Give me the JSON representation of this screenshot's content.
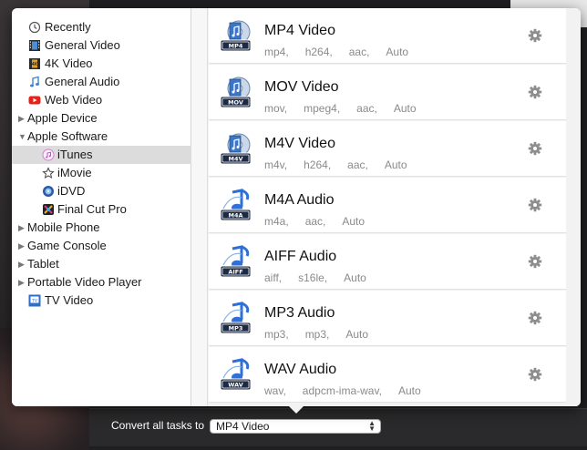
{
  "sidebar": {
    "items": [
      {
        "label": "Recently",
        "icon": "clock-icon",
        "selected": false
      },
      {
        "label": "General Video",
        "icon": "film-icon",
        "selected": false
      },
      {
        "label": "4K Video",
        "icon": "4k-film-icon",
        "selected": false
      },
      {
        "label": "General Audio",
        "icon": "music-note-icon",
        "selected": false
      },
      {
        "label": "Web Video",
        "icon": "youtube-icon",
        "selected": false
      },
      {
        "label": "Apple Device",
        "icon": "disclosure-right-icon",
        "selected": false
      },
      {
        "label": "Apple Software",
        "icon": "disclosure-down-icon",
        "selected": false
      },
      {
        "label": "iTunes",
        "icon": "itunes-icon",
        "selected": true
      },
      {
        "label": "iMovie",
        "icon": "imovie-star-icon",
        "selected": false
      },
      {
        "label": "iDVD",
        "icon": "idvd-icon",
        "selected": false
      },
      {
        "label": "Final Cut Pro",
        "icon": "final-cut-pro-icon",
        "selected": false
      },
      {
        "label": "Mobile Phone",
        "icon": "disclosure-right-icon",
        "selected": false
      },
      {
        "label": "Game Console",
        "icon": "disclosure-right-icon",
        "selected": false
      },
      {
        "label": "Tablet",
        "icon": "disclosure-right-icon",
        "selected": false
      },
      {
        "label": "Portable Video Player",
        "icon": "disclosure-right-icon",
        "selected": false
      },
      {
        "label": "TV Video",
        "icon": "tv-icon",
        "selected": false
      }
    ]
  },
  "formats": [
    {
      "title": "MP4 Video",
      "badge": "MP4",
      "kind": "video",
      "specs": [
        "mp4,",
        "h264,",
        "aac,",
        "Auto"
      ]
    },
    {
      "title": "MOV Video",
      "badge": "MOV",
      "kind": "video",
      "specs": [
        "mov,",
        "mpeg4,",
        "aac,",
        "Auto"
      ]
    },
    {
      "title": "M4V Video",
      "badge": "M4V",
      "kind": "video",
      "specs": [
        "m4v,",
        "h264,",
        "aac,",
        "Auto"
      ]
    },
    {
      "title": "M4A Audio",
      "badge": "M4A",
      "kind": "audio",
      "specs": [
        "m4a,",
        "aac,",
        "Auto"
      ]
    },
    {
      "title": "AIFF Audio",
      "badge": "AIFF",
      "kind": "audio",
      "specs": [
        "aiff,",
        "s16le,",
        "Auto"
      ]
    },
    {
      "title": "MP3 Audio",
      "badge": "MP3",
      "kind": "audio",
      "specs": [
        "mp3,",
        "mp3,",
        "Auto"
      ]
    },
    {
      "title": "WAV Audio",
      "badge": "WAV",
      "kind": "audio",
      "specs": [
        "wav,",
        "adpcm-ima-wav,",
        "Auto"
      ]
    }
  ],
  "bottom": {
    "convert_label": "Convert all tasks to",
    "selected_format": "MP4 Video"
  },
  "colors": {
    "selection": "#dcdcdc",
    "itunes_blue": "#2f6fd6",
    "badge_dark": "#1d2a44"
  }
}
